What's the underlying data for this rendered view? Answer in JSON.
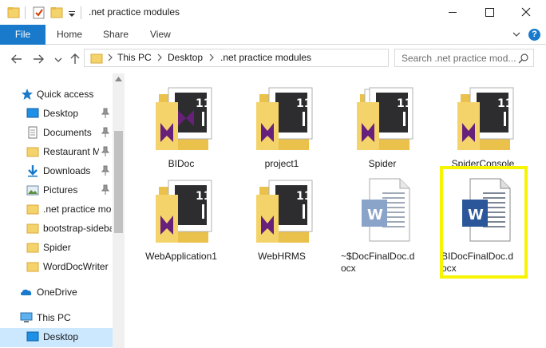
{
  "window": {
    "title": ".net practice modules",
    "controls": [
      "minimize",
      "maximize",
      "close"
    ]
  },
  "ribbon": {
    "tabs": [
      "File",
      "Home",
      "Share",
      "View"
    ]
  },
  "address": {
    "crumbs": [
      "This PC",
      "Desktop",
      ".net practice modules"
    ],
    "search_placeholder": "Search .net practice mod..."
  },
  "nav": {
    "quick_access": "Quick access",
    "items": [
      {
        "label": "Desktop",
        "icon": "desktop-icon",
        "pinned": true
      },
      {
        "label": "Documents",
        "icon": "documents-icon",
        "pinned": true
      },
      {
        "label": "Restaurant M",
        "icon": "folder-icon",
        "pinned": true
      },
      {
        "label": "Downloads",
        "icon": "downloads-icon",
        "pinned": true
      },
      {
        "label": "Pictures",
        "icon": "pictures-icon",
        "pinned": true
      },
      {
        "label": ".net practice mo",
        "icon": "folder-icon",
        "pinned": false
      },
      {
        "label": "bootstrap-sideba",
        "icon": "folder-icon",
        "pinned": false
      },
      {
        "label": "Spider",
        "icon": "folder-icon",
        "pinned": false
      },
      {
        "label": "WordDocWriter",
        "icon": "folder-icon",
        "pinned": false
      }
    ],
    "onedrive": "OneDrive",
    "this_pc": "This PC",
    "this_pc_desktop": "Desktop"
  },
  "files": [
    {
      "name": "BIDoc",
      "type": "vs-folder"
    },
    {
      "name": "project1",
      "type": "vs-folder"
    },
    {
      "name": "Spider",
      "type": "vs-folder"
    },
    {
      "name": "SpiderConsole",
      "type": "vs-folder"
    },
    {
      "name": "WebApplication1",
      "type": "vs-folder"
    },
    {
      "name": "WebHRMS",
      "type": "vs-folder"
    },
    {
      "name": "~$DocFinalDoc.d",
      "name2": "ocx",
      "type": "word-doc-temp"
    },
    {
      "name": "BIDocFinalDoc.d",
      "name2": "ocx",
      "type": "word-doc",
      "highlighted": true
    }
  ],
  "colors": {
    "accent": "#1979ca",
    "selection": "#cce8ff",
    "highlight": "#f6f400",
    "folder": "#f5d36b",
    "vs_purple": "#68217a",
    "word_blue": "#2b579a"
  }
}
